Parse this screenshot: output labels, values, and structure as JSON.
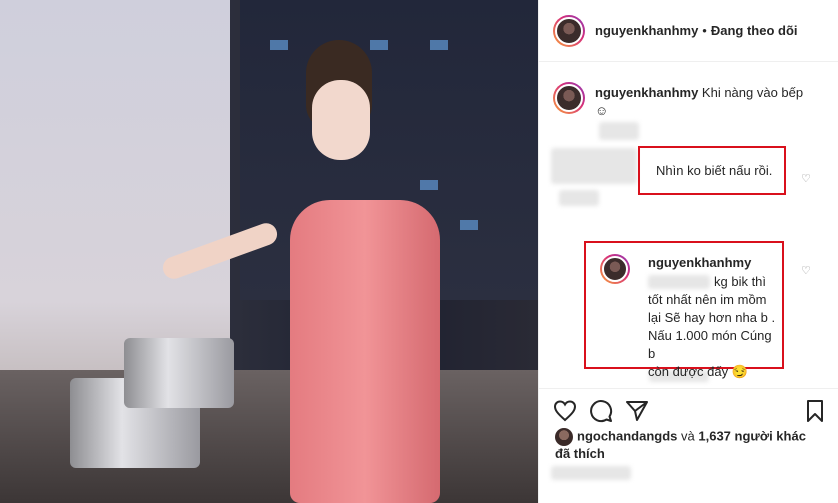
{
  "post": {
    "author": "nguyenkhanhmy",
    "follow_status": "Đang theo dõi",
    "separator": "•"
  },
  "caption": {
    "username": "nguyenkhanhmy",
    "text": "Khi nàng vào bếp",
    "emoji": "☺"
  },
  "comments": [
    {
      "text": "Nhìn ko biết nấu rồi."
    }
  ],
  "reply": {
    "username": "nguyenkhanhmy",
    "lines": [
      "kg bik thì",
      "tốt nhất nên im mồm",
      "lại Sẽ hay hơn nha b .",
      "Nấu 1.000 món Cúng b",
      "còn được đấy 😏"
    ]
  },
  "likes": {
    "first_user": "ngochandangds",
    "connector": "và",
    "count": "1,637",
    "suffix": "người khác",
    "line2": "đã thích"
  },
  "icons": {
    "like": "heart-icon",
    "comment": "comment-icon",
    "share": "share-icon",
    "save": "bookmark-icon"
  },
  "colors": {
    "highlight_box": "#d9101c",
    "text": "#262626",
    "muted": "#8e8e8e"
  }
}
